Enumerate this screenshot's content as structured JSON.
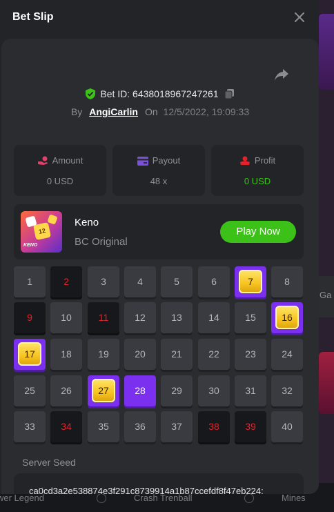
{
  "modal": {
    "title": "Bet Slip",
    "close_icon": "close-icon",
    "share_icon": "share-icon"
  },
  "bet": {
    "id_label": "Bet ID: 6438018967247261",
    "by_label": "By",
    "user": "AngiCarlin",
    "on_label": "On",
    "date": "12/5/2022, 19:09:33"
  },
  "stats": {
    "amount": {
      "label": "Amount",
      "value": "0 USD",
      "icon": "coins-hand-icon"
    },
    "payout": {
      "label": "Payout",
      "value": "48 x",
      "icon": "wallet-card-icon"
    },
    "profit": {
      "label": "Profit",
      "value": "0 USD",
      "icon": "profit-hand-icon"
    }
  },
  "game": {
    "name": "Keno",
    "provider": "BC Original",
    "thumb_tag": "KENO",
    "thumb_die": "12",
    "play_label": "Play Now"
  },
  "keno": {
    "cells": [
      {
        "n": "1",
        "state": "normal"
      },
      {
        "n": "2",
        "state": "miss"
      },
      {
        "n": "3",
        "state": "normal"
      },
      {
        "n": "4",
        "state": "normal"
      },
      {
        "n": "5",
        "state": "normal"
      },
      {
        "n": "6",
        "state": "normal"
      },
      {
        "n": "7",
        "state": "hit"
      },
      {
        "n": "8",
        "state": "normal"
      },
      {
        "n": "9",
        "state": "miss"
      },
      {
        "n": "10",
        "state": "normal"
      },
      {
        "n": "11",
        "state": "miss"
      },
      {
        "n": "12",
        "state": "normal"
      },
      {
        "n": "13",
        "state": "normal"
      },
      {
        "n": "14",
        "state": "normal"
      },
      {
        "n": "15",
        "state": "normal"
      },
      {
        "n": "16",
        "state": "hit"
      },
      {
        "n": "17",
        "state": "hit"
      },
      {
        "n": "18",
        "state": "normal"
      },
      {
        "n": "19",
        "state": "normal"
      },
      {
        "n": "20",
        "state": "normal"
      },
      {
        "n": "21",
        "state": "normal"
      },
      {
        "n": "22",
        "state": "normal"
      },
      {
        "n": "23",
        "state": "normal"
      },
      {
        "n": "24",
        "state": "normal"
      },
      {
        "n": "25",
        "state": "normal"
      },
      {
        "n": "26",
        "state": "normal"
      },
      {
        "n": "27",
        "state": "hit"
      },
      {
        "n": "28",
        "state": "hitonly"
      },
      {
        "n": "29",
        "state": "normal"
      },
      {
        "n": "30",
        "state": "normal"
      },
      {
        "n": "31",
        "state": "normal"
      },
      {
        "n": "32",
        "state": "normal"
      },
      {
        "n": "33",
        "state": "normal"
      },
      {
        "n": "34",
        "state": "miss"
      },
      {
        "n": "35",
        "state": "normal"
      },
      {
        "n": "36",
        "state": "normal"
      },
      {
        "n": "37",
        "state": "normal"
      },
      {
        "n": "38",
        "state": "miss"
      },
      {
        "n": "39",
        "state": "miss"
      },
      {
        "n": "40",
        "state": "normal"
      }
    ]
  },
  "seed": {
    "label": "Server Seed",
    "value": "ca0cd3a2e538874e3f291c8739914a1b87ccefdf8f47eb224:"
  },
  "background": {
    "side_text": "Ga",
    "bottom_items": [
      "wer Legend",
      "Crash Trenball",
      "Mines"
    ]
  },
  "colors": {
    "accent_green": "#3bc117",
    "hit_purple": "#7b2fef",
    "miss_red": "#e0232b"
  }
}
